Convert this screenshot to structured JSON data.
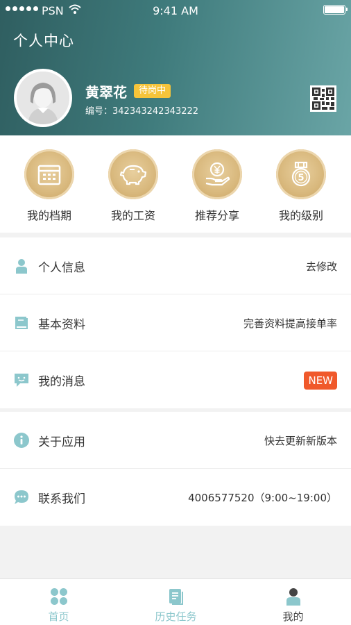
{
  "status_bar": {
    "carrier": "PSN",
    "time": "9:41 AM"
  },
  "header": {
    "title": "个人中心"
  },
  "profile": {
    "name": "黄翠花",
    "status": "待岗中",
    "id_label": "编号：342343242343222"
  },
  "shortcuts": [
    {
      "label": "我的档期",
      "icon": "calendar-icon"
    },
    {
      "label": "我的工资",
      "icon": "piggy-bank-icon"
    },
    {
      "label": "推荐分享",
      "icon": "yuan-hand-icon"
    },
    {
      "label": "我的级别",
      "icon": "medal-icon"
    }
  ],
  "menu_group_1": [
    {
      "title": "个人信息",
      "value": "去修改",
      "icon": "person-icon"
    },
    {
      "title": "基本资料",
      "value": "完善资料提高接单率",
      "icon": "book-icon"
    },
    {
      "title": "我的消息",
      "value": "NEW",
      "icon": "message-icon"
    }
  ],
  "menu_group_2": [
    {
      "title": "关于应用",
      "value": "快去更新新版本",
      "icon": "info-icon"
    },
    {
      "title": "联系我们",
      "value": "4006577520（9:00~19:00）",
      "icon": "chat-icon"
    }
  ],
  "tabbar": [
    {
      "label": "首页",
      "icon": "home-grid-icon"
    },
    {
      "label": "历史任务",
      "icon": "document-icon"
    },
    {
      "label": "我的",
      "icon": "user-icon"
    }
  ],
  "colors": {
    "header_start": "#2f5e60",
    "header_end": "#6aa5a6",
    "coin_gold": "#d9b97e",
    "badge_yellow": "#f6c43a",
    "new_badge": "#f0592b",
    "icon_teal": "#8cc7cc"
  }
}
